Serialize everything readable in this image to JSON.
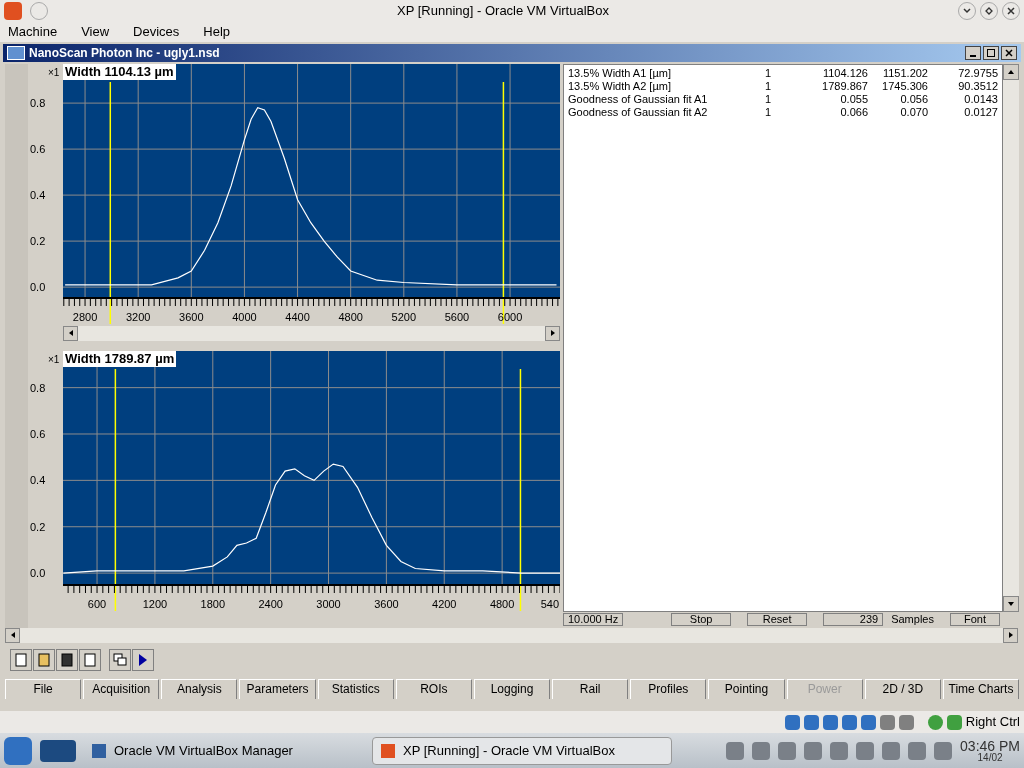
{
  "window": {
    "title": "XP [Running] - Oracle VM VirtualBox"
  },
  "menu": [
    "Machine",
    "View",
    "Devices",
    "Help"
  ],
  "app": {
    "title": "NanoScan Photon Inc - ugly1.nsd"
  },
  "charts": [
    {
      "scale": "×1",
      "width_label": "Width 1104.13 µm",
      "chart_data": {
        "type": "line",
        "x": [
          2650,
          2800,
          3000,
          3300,
          3500,
          3600,
          3700,
          3800,
          3900,
          4000,
          4050,
          4100,
          4150,
          4200,
          4300,
          4400,
          4500,
          4600,
          4700,
          4800,
          5000,
          5200,
          5600,
          6000,
          6350
        ],
        "series": [
          {
            "color": "#ffffff",
            "values": [
              0.01,
              0.01,
              0.01,
              0.01,
              0.04,
              0.07,
              0.16,
              0.28,
              0.44,
              0.64,
              0.73,
              0.78,
              0.77,
              0.72,
              0.56,
              0.38,
              0.28,
              0.2,
              0.13,
              0.07,
              0.03,
              0.02,
              0.01,
              0.01,
              0.01
            ]
          }
        ],
        "xlim": [
          2634,
          6376
        ],
        "ylim": [
          -0.043,
          0.97
        ],
        "xticks": [
          2800,
          3200,
          3600,
          4000,
          4400,
          4800,
          5200,
          5600,
          6000
        ],
        "yticks": [
          {
            "value": 0,
            "label": "0.0"
          },
          {
            "value": 0.2,
            "label": "0.2"
          },
          {
            "value": 0.4,
            "label": "0.4"
          },
          {
            "value": 0.6,
            "label": "0.6"
          },
          {
            "value": 0.8,
            "label": "0.8"
          }
        ],
        "grid": true,
        "ref_lines": [
          {
            "axis": "x",
            "value": 2990,
            "color": "#ffff00"
          },
          {
            "axis": "x",
            "value": 5950,
            "color": "#ffff00"
          }
        ]
      }
    },
    {
      "scale": "×1",
      "width_label": "Width 1789.87 µm",
      "edge_tick_label": "540",
      "chart_data": {
        "type": "line",
        "x": [
          250,
          600,
          900,
          1500,
          1800,
          1950,
          2050,
          2150,
          2250,
          2350,
          2450,
          2550,
          2650,
          2750,
          2850,
          2950,
          3050,
          3150,
          3300,
          3450,
          3600,
          3750,
          3900,
          4200,
          4600,
          5000,
          5400
        ],
        "series": [
          {
            "color": "#ffffff",
            "values": [
              0.0,
              0.01,
              0.01,
              0.01,
              0.03,
              0.07,
              0.12,
              0.13,
              0.15,
              0.26,
              0.38,
              0.44,
              0.45,
              0.42,
              0.4,
              0.44,
              0.47,
              0.46,
              0.37,
              0.24,
              0.12,
              0.05,
              0.02,
              0.01,
              0.01,
              0.0,
              0.0
            ]
          }
        ],
        "xlim": [
          247,
          5400
        ],
        "ylim": [
          -0.047,
          0.958
        ],
        "xticks": [
          600,
          1200,
          1800,
          2400,
          3000,
          3600,
          4200,
          4800
        ],
        "yticks": [
          {
            "value": 0,
            "label": "0.0"
          },
          {
            "value": 0.2,
            "label": "0.2"
          },
          {
            "value": 0.4,
            "label": "0.4"
          },
          {
            "value": 0.6,
            "label": "0.6"
          },
          {
            "value": 0.8,
            "label": "0.8"
          }
        ],
        "grid": true,
        "ref_lines": [
          {
            "axis": "x",
            "value": 790,
            "color": "#ffff00"
          },
          {
            "axis": "x",
            "value": 4990,
            "color": "#ffff00"
          }
        ]
      }
    }
  ],
  "results": [
    {
      "name": "13.5% Width A1 [µm]",
      "column_2": "1",
      "column_3": "1104.126",
      "column_4": "1151.202",
      "column_5": "72.9755"
    },
    {
      "name": "13.5% Width A2 [µm]",
      "column_2": "1",
      "column_3": "1789.867",
      "column_4": "1745.306",
      "column_5": "90.3512"
    },
    {
      "name": "Goodness of Gaussian fit A1",
      "column_2": "1",
      "column_3": "0.055",
      "column_4": "0.056",
      "column_5": "0.0143"
    },
    {
      "name": "Goodness of Gaussian fit A2",
      "column_2": "1",
      "column_3": "0.066",
      "column_4": "0.070",
      "column_5": "0.0127"
    }
  ],
  "controls": {
    "rate": "10.000 Hz",
    "stop": "Stop",
    "reset": "Reset",
    "samples_count": "239",
    "samples_label": "Samples",
    "font": "Font"
  },
  "tabs": [
    {
      "label": "File",
      "disabled": false
    },
    {
      "label": "Acquisition",
      "disabled": false
    },
    {
      "label": "Analysis",
      "disabled": false
    },
    {
      "label": "Parameters",
      "disabled": false
    },
    {
      "label": "Statistics",
      "disabled": false
    },
    {
      "label": "ROIs",
      "disabled": false
    },
    {
      "label": "Logging",
      "disabled": false
    },
    {
      "label": "Rail",
      "disabled": false
    },
    {
      "label": "Profiles",
      "disabled": false
    },
    {
      "label": "Pointing",
      "disabled": false
    },
    {
      "label": "Power",
      "disabled": true
    },
    {
      "label": "2D / 3D",
      "disabled": false
    },
    {
      "label": "Time Charts",
      "disabled": false
    }
  ],
  "status_bar": {
    "host_key": "Right Ctrl"
  },
  "taskbar": {
    "tasks": [
      {
        "label": "Oracle VM VirtualBox Manager",
        "selected": false
      },
      {
        "label": "XP [Running] - Oracle VM VirtualBox",
        "selected": true
      }
    ],
    "time": "03:46 PM",
    "date": "14/02"
  }
}
